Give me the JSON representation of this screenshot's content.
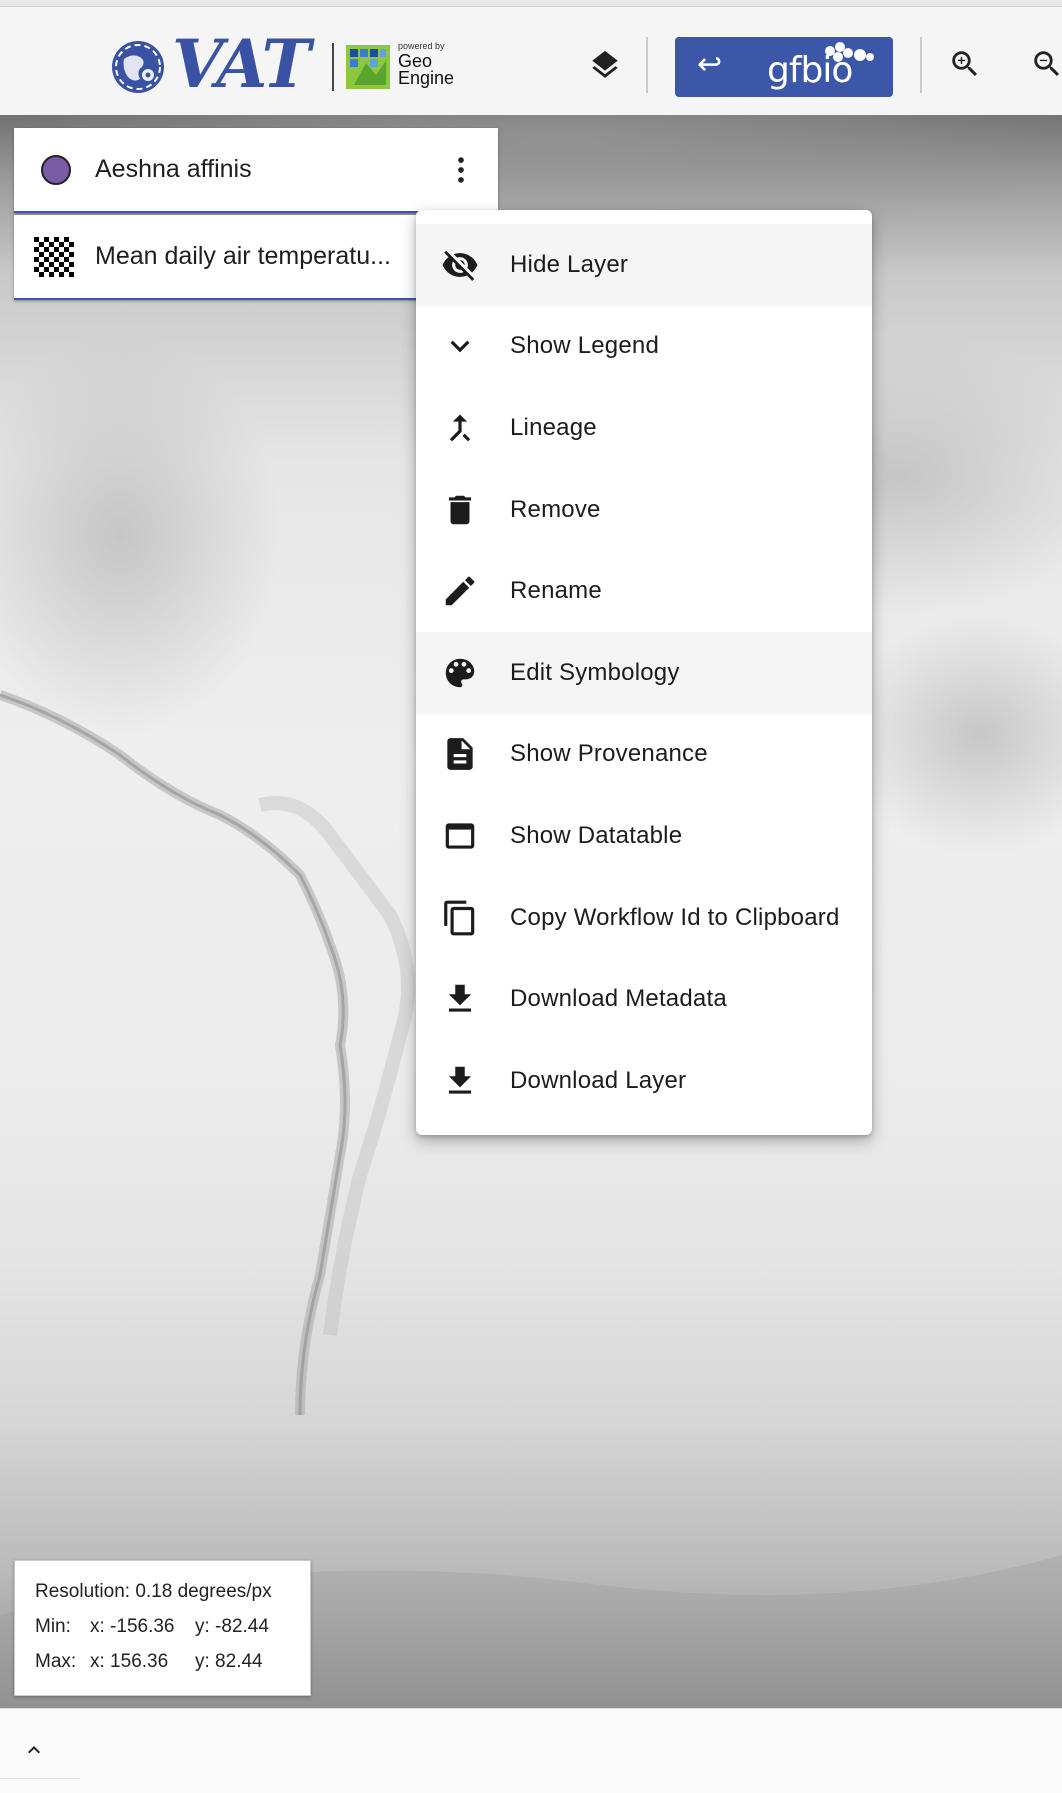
{
  "header": {
    "logo_text": "VAT",
    "geoengine_powered": "powered by",
    "geoengine_name_line1": "Geo",
    "geoengine_name_line2": "Engine",
    "gfbio_arrow": "↩",
    "gfbio_label": "gfbio"
  },
  "layers": [
    {
      "name": "Aeshna affinis",
      "symbol": "purple-circle",
      "color": "#7b5aa6"
    },
    {
      "name": "Mean daily air temperatu...",
      "symbol": "checkerboard-raster"
    }
  ],
  "context_menu": {
    "items": [
      {
        "label": "Hide Layer",
        "icon": "visibility-off-icon",
        "highlighted": true
      },
      {
        "label": "Show Legend",
        "icon": "chevron-down-icon"
      },
      {
        "label": "Lineage",
        "icon": "merge-icon"
      },
      {
        "label": "Remove",
        "icon": "trash-icon"
      },
      {
        "label": "Rename",
        "icon": "pencil-icon"
      },
      {
        "label": "Edit Symbology",
        "icon": "palette-icon",
        "highlighted": true
      },
      {
        "label": "Show Provenance",
        "icon": "document-icon"
      },
      {
        "label": "Show Datatable",
        "icon": "table-window-icon"
      },
      {
        "label": "Copy Workflow Id to Clipboard",
        "icon": "copy-icon"
      },
      {
        "label": "Download Metadata",
        "icon": "download-icon"
      },
      {
        "label": "Download Layer",
        "icon": "download-icon"
      }
    ]
  },
  "info_box": {
    "resolution": "Resolution: 0.18 degrees/px",
    "min_label": "Min:",
    "min_x": "x: -156.36",
    "min_y": "y: -82.44",
    "max_label": "Max:",
    "max_x": "x: 156.36",
    "max_y": "y: 82.44"
  },
  "colors": {
    "brand_blue": "#3c57a8",
    "layer_circle": "#7b5aa6",
    "menu_highlight": "#f5f5f5"
  }
}
